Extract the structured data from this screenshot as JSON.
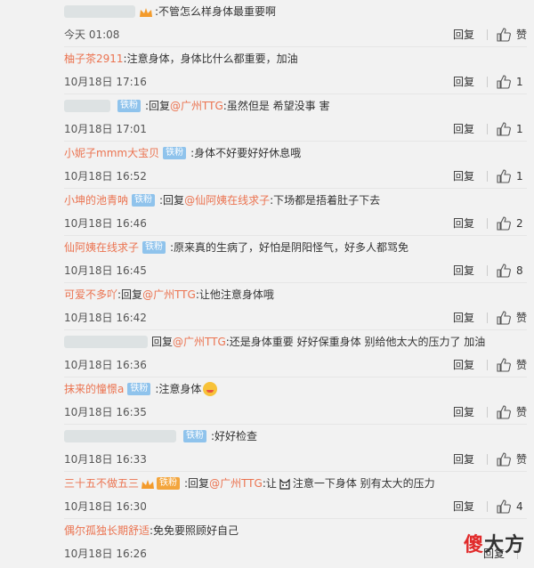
{
  "comments": [
    {
      "user": "",
      "badge": "",
      "content": ":不管怎么样身体最重要啊",
      "time": "今天 01:08",
      "reply": "回复",
      "likes": "赞"
    },
    {
      "user": "柚子茶2911",
      "badge": "",
      "content": ":注意身体，身体比什么都重要，加油",
      "time": "10月18日 17:16",
      "reply": "回复",
      "likes": "1"
    },
    {
      "user": "",
      "badge": "铁粉",
      "prefix": ":回复",
      "mention": "@广州TTG",
      "content": ":虽然但是 希望没事 害",
      "time": "10月18日 17:01",
      "reply": "回复",
      "likes": "1"
    },
    {
      "user": "小妮子mmm大宝贝",
      "badge": "铁粉",
      "content": ":身体不好要好好休息哦",
      "time": "10月18日 16:52",
      "reply": "回复",
      "likes": "1"
    },
    {
      "user": "小坤的池青呐",
      "badge": "铁粉",
      "prefix": ":回复",
      "mention": "@仙阿姨在线求子",
      "content": ":下场都是捂着肚子下去",
      "time": "10月18日 16:46",
      "reply": "回复",
      "likes": "2"
    },
    {
      "user": "仙阿姨在线求子",
      "badge": "铁粉",
      "content": ":原来真的生病了，好怕是阴阳怪气，好多人都骂免",
      "time": "10月18日 16:45",
      "reply": "回复",
      "likes": "8"
    },
    {
      "user": "可爱不多吖",
      "badge": "",
      "prefix": ":回复",
      "mention": "@广州TTG",
      "content": ":让他注意身体哦",
      "time": "10月18日 16:42",
      "reply": "回复",
      "likes": "赞"
    },
    {
      "user": "",
      "badge": "",
      "prefix": "回复",
      "mention": "@广州TTG",
      "content": ":还是身体重要 好好保重身体 别给他太大的压力了 加油",
      "time": "10月18日 16:36",
      "reply": "回复",
      "likes": "赞"
    },
    {
      "user": "抹来的憧憬a",
      "badge": "铁粉",
      "content": ":注意身体",
      "time": "10月18日 16:35",
      "reply": "回复",
      "likes": "赞"
    },
    {
      "user": "",
      "badge": "铁粉",
      "content": ":好好检查",
      "time": "10月18日 16:33",
      "reply": "回复",
      "likes": "赞"
    },
    {
      "user": "三十五不做五三",
      "badge": "铁粉",
      "prefix": ":回复",
      "mention": "@广州TTG",
      "content": ":让",
      "content2": "注意一下身体 别有太大的压力",
      "time": "10月18日 16:30",
      "reply": "回复",
      "likes": "4"
    },
    {
      "user": "偶尔孤独长期舒适",
      "badge": "",
      "content": ":免免要照顾好自己",
      "time": "10月18日 16:26",
      "reply": "回复",
      "likes": ""
    }
  ],
  "watermark": {
    "part1": "傻",
    "part2": "大方"
  },
  "icons": {
    "thumb": "thumbs-up-icon",
    "badge_color": "#8fc3ec",
    "user_color": "#eb7350"
  }
}
